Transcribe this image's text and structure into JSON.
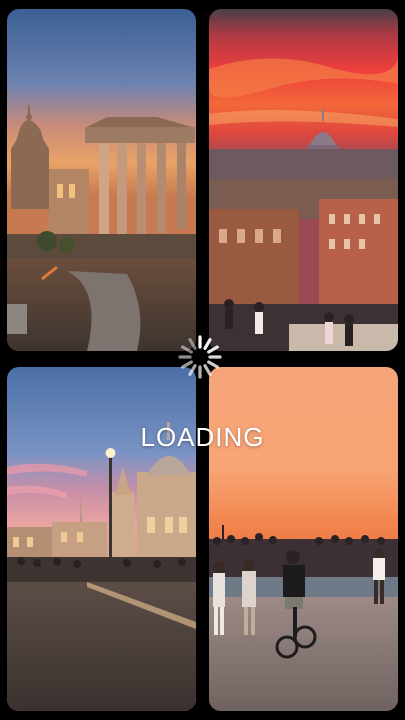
{
  "loader": {
    "label": "LOADING",
    "icon": "spinner-icon",
    "color": "#ffffff"
  },
  "gallery": {
    "tiles": [
      {
        "name": "roman-forum-sunset"
      },
      {
        "name": "rome-rooftops-red-sky"
      },
      {
        "name": "piazza-navona-dusk"
      },
      {
        "name": "spanish-steps-crowd-sunset"
      }
    ]
  }
}
